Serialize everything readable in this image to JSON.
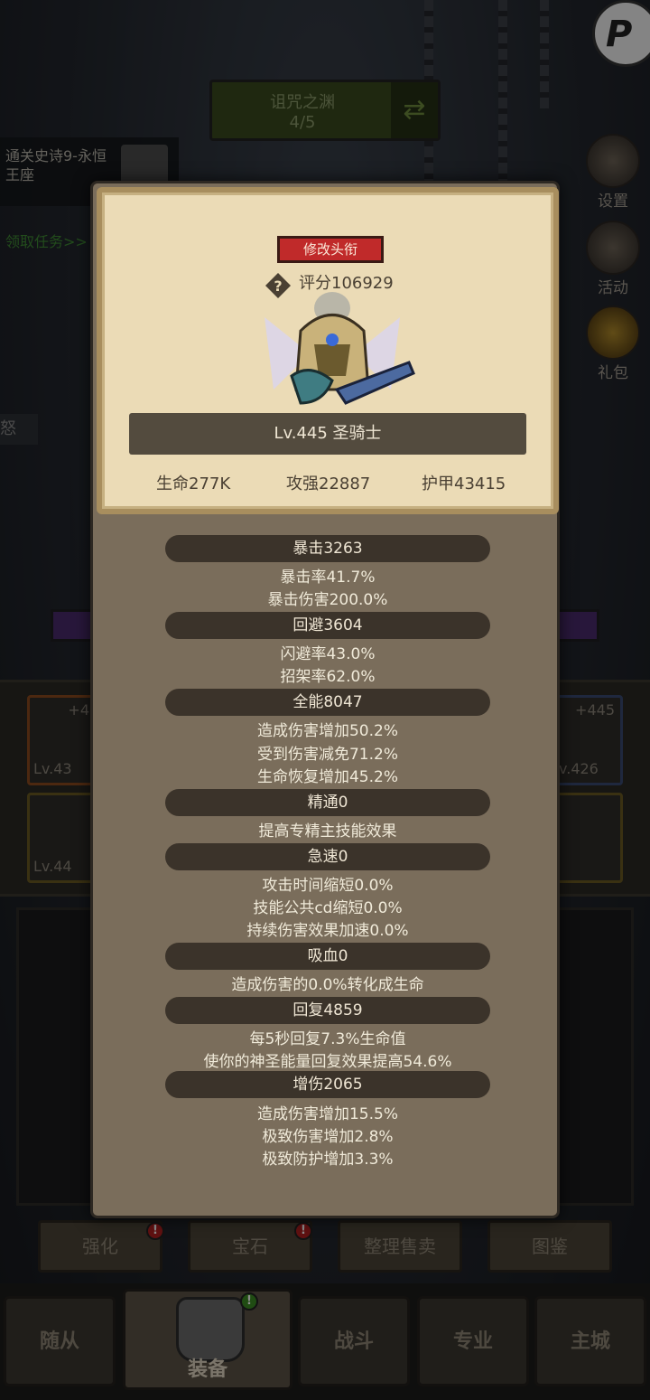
{
  "background": {
    "stage_name": "诅咒之渊",
    "stage_progress": "4/5",
    "quest_text": "通关史诗9-永恒王座",
    "quest_link": "领取任务>>",
    "rage_label": "怒",
    "avatar_letter": "P",
    "side_buttons": [
      {
        "label": "设置",
        "icon": "gear-icon"
      },
      {
        "label": "活动",
        "icon": "scroll-icon"
      },
      {
        "label": "礼包",
        "icon": "gift-icon"
      }
    ],
    "equip_slots": [
      {
        "plus": "+4",
        "level": "Lv.43"
      },
      {
        "plus": "",
        "level": "Lv.44"
      },
      {
        "plus": "+445",
        "level": "v.426"
      },
      {
        "plus": "",
        "level": ""
      }
    ],
    "actions": [
      {
        "label": "强化",
        "alert": "!"
      },
      {
        "label": "宝石",
        "alert": "!"
      },
      {
        "label": "整理售卖",
        "alert": ""
      },
      {
        "label": "图鉴",
        "alert": ""
      }
    ],
    "nav": [
      {
        "label": "随从"
      },
      {
        "label": "装备",
        "badge": "!"
      },
      {
        "label": "战斗"
      },
      {
        "label": "专业"
      },
      {
        "label": "主城"
      }
    ]
  },
  "popup": {
    "title_button": "修改头衔",
    "score": "评分106929",
    "class_line": "Lv.445 圣骑士",
    "stats": {
      "hp": "生命277K",
      "attack": "攻强22887",
      "armor": "护甲43415"
    },
    "sections": [
      {
        "header": "暴击3263",
        "lines": [
          "暴击率41.7%",
          "暴击伤害200.0%"
        ]
      },
      {
        "header": "回避3604",
        "lines": [
          "闪避率43.0%",
          "招架率62.0%"
        ]
      },
      {
        "header": "全能8047",
        "lines": [
          "造成伤害增加50.2%",
          "受到伤害减免71.2%",
          "生命恢复增加45.2%"
        ]
      },
      {
        "header": "精通0",
        "lines": [
          "提高专精主技能效果"
        ]
      },
      {
        "header": "急速0",
        "lines": [
          "攻击时间缩短0.0%",
          "技能公共cd缩短0.0%",
          "持续伤害效果加速0.0%"
        ]
      },
      {
        "header": "吸血0",
        "lines": [
          "造成伤害的0.0%转化成生命"
        ]
      },
      {
        "header": "回复4859",
        "lines": [
          "每5秒回复7.3%生命值",
          "使你的神圣能量回复效果提高54.6%"
        ]
      },
      {
        "header": "增伤2065",
        "lines": [
          "造成伤害增加15.5%",
          "极致伤害增加2.8%",
          "极致防护增加3.3%"
        ]
      }
    ]
  },
  "colors": {
    "popup_frame": "#7a6d5b",
    "card_parchment": "#ebdbb6",
    "title_button": "#c02a2a",
    "section_header": "#3b332a"
  }
}
